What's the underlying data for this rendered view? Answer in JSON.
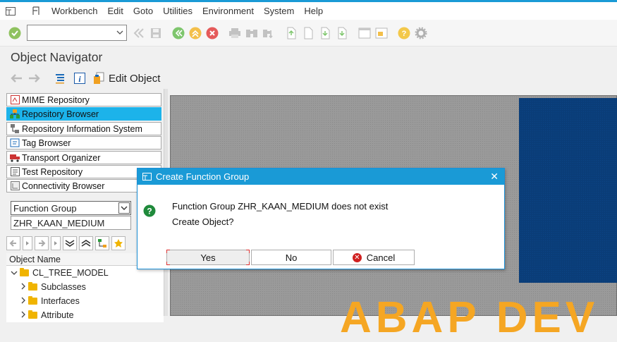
{
  "menu": {
    "items": [
      "Workbench",
      "Edit",
      "Goto",
      "Utilities",
      "Environment",
      "System",
      "Help"
    ]
  },
  "toolbar": {
    "command_value": "",
    "icons": [
      "enter-check-icon",
      "dropdown-icon",
      "back-double-icon",
      "save-icon",
      "back-icon",
      "exit-icon",
      "cancel-icon",
      "print-icon",
      "find-icon",
      "find-next-icon",
      "first-page-icon",
      "prev-page-icon",
      "next-page-icon",
      "last-page-icon",
      "create-session-icon",
      "shortcut-icon",
      "help-icon",
      "settings-gear-icon"
    ]
  },
  "title": "Object Navigator",
  "app_toolbar": {
    "edit_object_label": "Edit Object"
  },
  "nav": {
    "items": [
      {
        "label": "MIME Repository",
        "active": false
      },
      {
        "label": "Repository Browser",
        "active": true
      },
      {
        "label": "Repository Information System",
        "active": false
      },
      {
        "label": "Tag Browser",
        "active": false
      },
      {
        "label": "Transport Organizer",
        "active": false
      },
      {
        "label": "Test Repository",
        "active": false
      },
      {
        "label": "Connectivity Browser",
        "active": false
      }
    ]
  },
  "object_type": {
    "selected": "Function Group"
  },
  "object_name_value": "ZHR_KAAN_MEDIUM",
  "tree": {
    "header": "Object Name",
    "root": "CL_TREE_MODEL",
    "children": [
      "Subclasses",
      "Interfaces",
      "Attribute"
    ]
  },
  "background": {
    "banner_text": "ABAP DEV"
  },
  "dialog": {
    "title": "Create Function Group",
    "message_line1": "Function Group ZHR_KAAN_MEDIUM does not exist",
    "message_line2": "Create Object?",
    "yes_label": "Yes",
    "no_label": "No",
    "cancel_label": "Cancel"
  },
  "colors": {
    "accent": "#1a9ad6",
    "active_nav": "#1cb3ea",
    "folder": "#f0b400",
    "banner": "#f5a623",
    "cancel_red": "#d02020",
    "question_green": "#1f8a3b"
  }
}
